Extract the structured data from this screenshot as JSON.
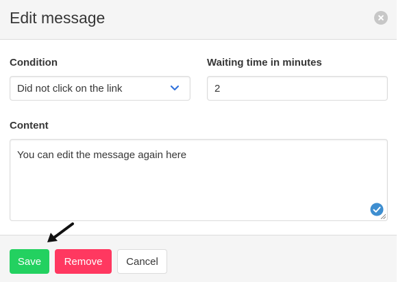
{
  "modal": {
    "title": "Edit message",
    "close_icon": "close-icon"
  },
  "form": {
    "condition": {
      "label": "Condition",
      "selected": "Did not click on the link",
      "icon": "chevron-down-icon"
    },
    "waiting_time": {
      "label": "Waiting time in minutes",
      "value": "2"
    },
    "content": {
      "label": "Content",
      "value": "You can edit the message again here",
      "badge_icon": "check-circle-icon"
    }
  },
  "footer": {
    "save_label": "Save",
    "remove_label": "Remove",
    "cancel_label": "Cancel"
  },
  "colors": {
    "save": "#23d160",
    "remove": "#ff3860",
    "header_bg": "#f5f5f5",
    "badge": "#3e8ed0"
  },
  "annotation": {
    "arrow_icon": "arrow-pointer-icon"
  }
}
